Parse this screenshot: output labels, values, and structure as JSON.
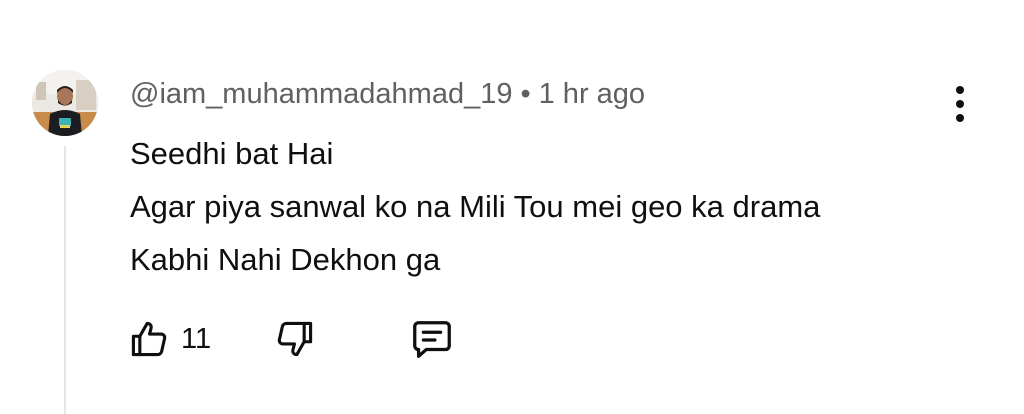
{
  "comment": {
    "username": "@iam_muhammadahmad_19",
    "separator": "•",
    "time": "1 hr ago",
    "lines": [
      "Seedhi bat Hai",
      "Agar piya sanwal ko na Mili Tou mei geo ka drama",
      "Kabhi Nahi Dekhon ga"
    ],
    "like_count": "11"
  },
  "icons": {
    "like": "thumbs-up-icon",
    "dislike": "thumbs-down-icon",
    "reply": "comment-reply-icon",
    "more": "more-vertical-icon"
  },
  "colors": {
    "text": "#0f0f0f",
    "meta": "#606060",
    "thread_line": "#e5e5e5"
  }
}
